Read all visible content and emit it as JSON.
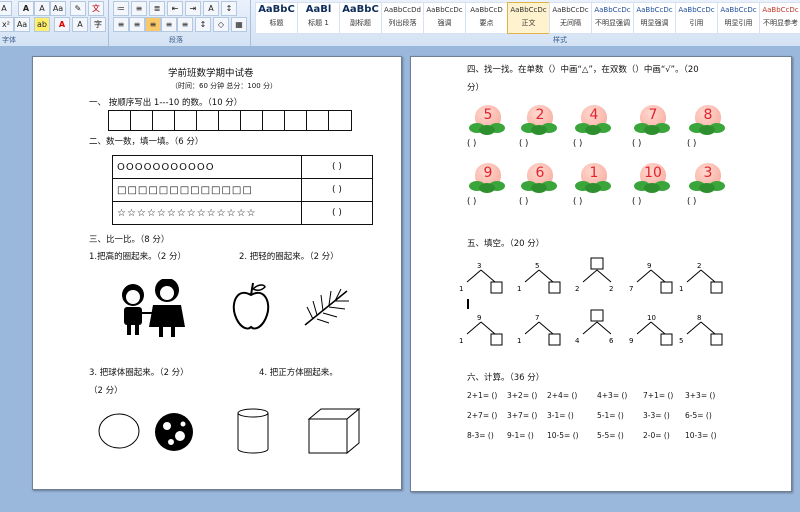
{
  "ribbon": {
    "font_group_label": "字体",
    "paragraph_group_label": "段落",
    "styles_group_label": "样式",
    "left_edge_label": "A",
    "styles": [
      {
        "preview": "AaBbC",
        "name": "标题"
      },
      {
        "preview": "AaBl",
        "name": "标题 1"
      },
      {
        "preview": "AaBbC",
        "name": "副标题"
      },
      {
        "preview": "AaBbCcDd",
        "name": "列出段落"
      },
      {
        "preview": "AaBbCcDc",
        "name": "强调"
      },
      {
        "preview": "AaBbCcD",
        "name": "要点"
      },
      {
        "preview": "AaBbCcDc",
        "name": "正文"
      },
      {
        "preview": "AaBbCcDc",
        "name": "无间隔"
      },
      {
        "preview": "AaBbCcDc",
        "name": "不明显强调"
      },
      {
        "preview": "AaBbCcDc",
        "name": "明显强调"
      },
      {
        "preview": "AaBbCcDc",
        "name": "引用"
      },
      {
        "preview": "AaBbCcDc",
        "name": "明显引用"
      },
      {
        "preview": "AaBbCcDc",
        "name": "不明显参考"
      }
    ]
  },
  "page1": {
    "title": "学前班数学期中试卷",
    "subtitle": "（时间：60 分钟    总分：100 分）",
    "q1": "一、  按顺序写出 1---10 的数。（10 分）",
    "q2": "二、数一数，填一填。（6 分）",
    "table_rows": [
      {
        "symbols": "OOOOOOOOOOO",
        "answer": "(          )"
      },
      {
        "symbols": "□□□□□□□□□□□□□",
        "answer": "(          )"
      },
      {
        "symbols": "☆☆☆☆☆☆☆☆☆☆☆☆☆☆",
        "answer": "(          )"
      }
    ],
    "q3": "三、比一比。（8 分）",
    "q3_1": "1.把高的圈起来。（2 分）",
    "q3_2": "2.  把轻的圈起来。（2 分）",
    "q3_3": "3.  把球体圈起来。（2 分）",
    "q3_4": "4.  把正方体圈起来。",
    "q3_4b": "（2 分）"
  },
  "page2": {
    "q4": "四、找一找。在单数（）中画“△”，在双数（）中画“√”。（20",
    "q4b": "分）",
    "peaches_row1": [
      "5",
      "2",
      "4",
      "7",
      "8"
    ],
    "peaches_row2": [
      "9",
      "6",
      "1",
      "10",
      "3"
    ],
    "paren": "(       )",
    "q5": "五、填空。（20 分）",
    "split_row1": [
      {
        "top": "3",
        "left": "1",
        "right": ""
      },
      {
        "top": "5",
        "left": "1",
        "right": ""
      },
      {
        "top": "",
        "left": "2",
        "right": "2"
      },
      {
        "top": "9",
        "left": "7",
        "right": ""
      },
      {
        "top": "2",
        "left": "1",
        "right": ""
      }
    ],
    "split_row2": [
      {
        "top": "9",
        "left": "1",
        "right": ""
      },
      {
        "top": "7",
        "left": "1",
        "right": ""
      },
      {
        "top": "",
        "left": "4",
        "right": "6"
      },
      {
        "top": "10",
        "left": "9",
        "right": ""
      },
      {
        "top": "8",
        "left": "5",
        "right": ""
      }
    ],
    "q6": "六、计算。（36 分）",
    "calc_rows": [
      [
        "2+1= ()",
        "3+2= ()",
        "2+4= ()",
        "4+3= ()",
        "7+1= ()",
        "3+3= ()"
      ],
      [
        "2+7= ()",
        "3+7= ()",
        "3-1= ()",
        "5-1= ()",
        "3-3= ()",
        "6-5= ()"
      ],
      [
        "8-3= ()",
        "9-1= ()",
        "10-5= ()",
        "5-5= ()",
        "2-0= ()",
        "10-3= ()"
      ]
    ]
  }
}
